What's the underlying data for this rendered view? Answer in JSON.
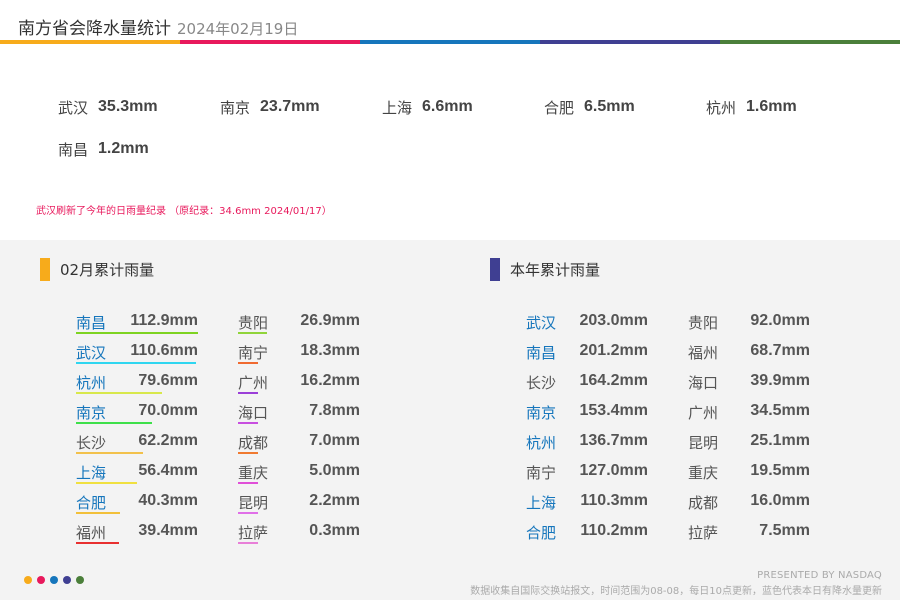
{
  "header": {
    "title": "南方省会降水量统计",
    "date": "2024年02月19日",
    "colors": [
      "#f7ab1b",
      "#e8195c",
      "#1676bc",
      "#3f3f92",
      "#4b7f3a"
    ]
  },
  "today": [
    {
      "city": "武汉",
      "value": "35.3mm"
    },
    {
      "city": "南京",
      "value": "23.7mm"
    },
    {
      "city": "上海",
      "value": "6.6mm"
    },
    {
      "city": "合肥",
      "value": "6.5mm"
    },
    {
      "city": "杭州",
      "value": "1.6mm"
    },
    {
      "city": "南昌",
      "value": "1.2mm"
    }
  ],
  "record_note": "武汉刷新了今年的日雨量纪录 （原纪录：34.6mm 2024/01/17）",
  "monthly": {
    "title": "02月累计雨量",
    "bar_color": "#f7ab1b",
    "items": [
      {
        "city": "南昌",
        "value": "112.9mm",
        "num": 112.9,
        "blue": true,
        "line_color": "#7ed321"
      },
      {
        "city": "武汉",
        "value": "110.6mm",
        "num": 110.6,
        "blue": true,
        "line_color": "#2fd6f0"
      },
      {
        "city": "杭州",
        "value": "79.6mm",
        "num": 79.6,
        "blue": true,
        "line_color": "#d8e84b"
      },
      {
        "city": "南京",
        "value": "70.0mm",
        "num": 70.0,
        "blue": true,
        "line_color": "#3ee04a"
      },
      {
        "city": "长沙",
        "value": "62.2mm",
        "num": 62.2,
        "blue": false,
        "line_color": "#f2c14b"
      },
      {
        "city": "上海",
        "value": "56.4mm",
        "num": 56.4,
        "blue": true,
        "line_color": "#f0e040"
      },
      {
        "city": "合肥",
        "value": "40.3mm",
        "num": 40.3,
        "blue": true,
        "line_color": "#f2c03a"
      },
      {
        "city": "福州",
        "value": "39.4mm",
        "num": 39.4,
        "blue": false,
        "line_color": "#e83030"
      },
      {
        "city": "贵阳",
        "value": "26.9mm",
        "num": 26.9,
        "blue": false,
        "line_color": "#90d43a"
      },
      {
        "city": "南宁",
        "value": "18.3mm",
        "num": 18.3,
        "blue": false,
        "line_color": "#f06a30"
      },
      {
        "city": "广州",
        "value": "16.2mm",
        "num": 16.2,
        "blue": false,
        "line_color": "#9b3fd8"
      },
      {
        "city": "海口",
        "value": "7.8mm",
        "num": 7.8,
        "blue": false,
        "line_color": "#c84fe0"
      },
      {
        "city": "成都",
        "value": "7.0mm",
        "num": 7.0,
        "blue": false,
        "line_color": "#f07a30"
      },
      {
        "city": "重庆",
        "value": "5.0mm",
        "num": 5.0,
        "blue": false,
        "line_color": "#e04fd8"
      },
      {
        "city": "昆明",
        "value": "2.2mm",
        "num": 2.2,
        "blue": false,
        "line_color": "#e06fe8"
      },
      {
        "city": "拉萨",
        "value": "0.3mm",
        "num": 0.3,
        "blue": false,
        "line_color": "#e87fd8"
      }
    ]
  },
  "yearly": {
    "title": "本年累计雨量",
    "bar_color": "#3f3f92",
    "items": [
      {
        "city": "武汉",
        "value": "203.0mm",
        "blue": true
      },
      {
        "city": "南昌",
        "value": "201.2mm",
        "blue": true
      },
      {
        "city": "长沙",
        "value": "164.2mm",
        "blue": false
      },
      {
        "city": "南京",
        "value": "153.4mm",
        "blue": true
      },
      {
        "city": "杭州",
        "value": "136.7mm",
        "blue": true
      },
      {
        "city": "南宁",
        "value": "127.0mm",
        "blue": false
      },
      {
        "city": "上海",
        "value": "110.3mm",
        "blue": true
      },
      {
        "city": "合肥",
        "value": "110.2mm",
        "blue": true
      },
      {
        "city": "贵阳",
        "value": "92.0mm",
        "blue": false
      },
      {
        "city": "福州",
        "value": "68.7mm",
        "blue": false
      },
      {
        "city": "海口",
        "value": "39.9mm",
        "blue": false
      },
      {
        "city": "广州",
        "value": "34.5mm",
        "blue": false
      },
      {
        "city": "昆明",
        "value": "25.1mm",
        "blue": false
      },
      {
        "city": "重庆",
        "value": "19.5mm",
        "blue": false
      },
      {
        "city": "成都",
        "value": "16.0mm",
        "blue": false
      },
      {
        "city": "拉萨",
        "value": "7.5mm",
        "blue": false
      }
    ]
  },
  "footer": {
    "dot_colors": [
      "#f7ab1b",
      "#e8195c",
      "#1676bc",
      "#3f3f92",
      "#4b7f3a"
    ],
    "brand": "PRESENTED BY NASDAQ",
    "note": "数据收集自国际交换站报文，时间范围为08-08，每日10点更新，蓝色代表本日有降水量更新"
  }
}
